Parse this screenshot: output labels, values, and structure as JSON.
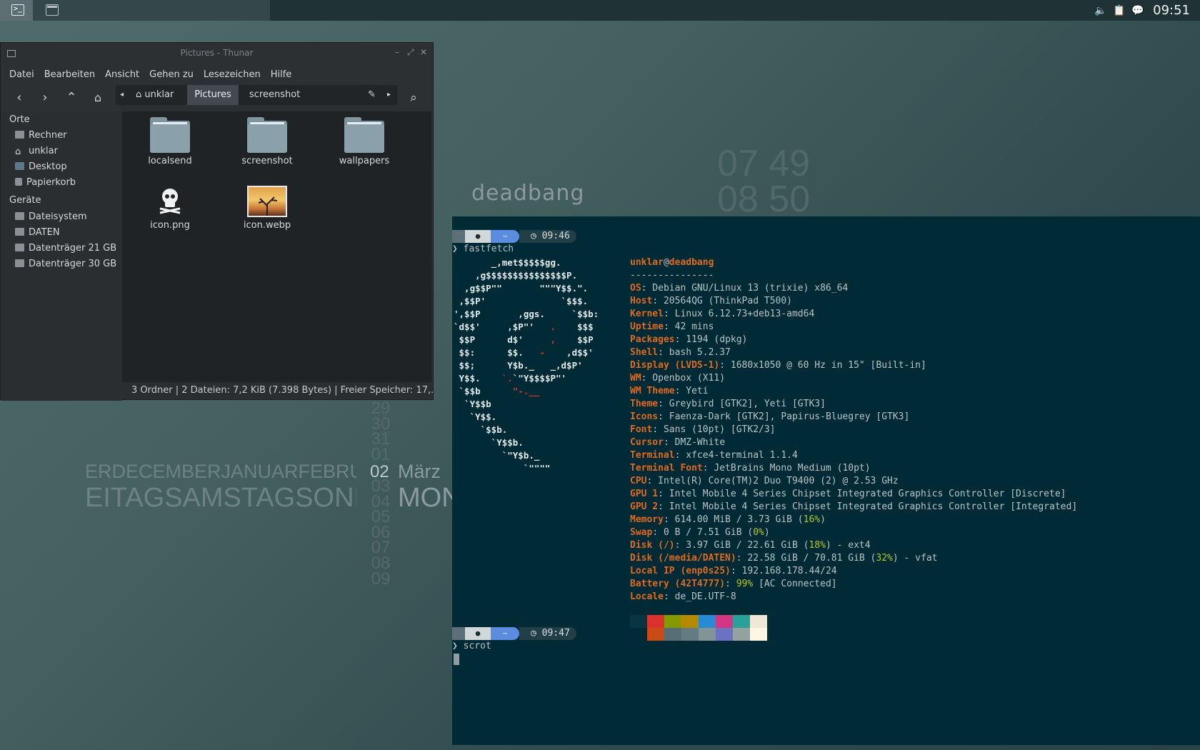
{
  "panel": {
    "tray_icons": [
      "speaker-icon",
      "clipboard-icon",
      "chat-icon"
    ],
    "clock": "09:51"
  },
  "thunar": {
    "title": "Pictures - Thunar",
    "menu": [
      "Datei",
      "Bearbeiten",
      "Ansicht",
      "Gehen zu",
      "Lesezeichen",
      "Hilfe"
    ],
    "path": [
      "unklar",
      "Pictures",
      "screenshot"
    ],
    "sidebar": {
      "places_header": "Orte",
      "places": [
        "Rechner",
        "unklar",
        "Desktop",
        "Papierkorb"
      ],
      "devices_header": "Geräte",
      "devices": [
        "Dateisystem",
        "DATEN",
        "Datenträger 21 GB",
        "Datenträger 30 GB"
      ]
    },
    "files": [
      "localsend",
      "screenshot",
      "wallpapers",
      "icon.png",
      "icon.webp"
    ],
    "status": "3 Ordner  |  2 Dateien: 7,2 KiB (7.398 Bytes)  |  Freier Speicher: 17,..."
  },
  "desktop": {
    "hostname_logo": "deadbang",
    "clock_rows": [
      "07  49",
      "08  50"
    ],
    "months": "ERDECEMBERJANUARFEBRUAR",
    "days": "EITAGSAMSTAGSONNTAG",
    "numbers_above": [
      "29",
      "30",
      "31",
      "01"
    ],
    "current_number": "02",
    "numbers_below": [
      "03",
      "04",
      "05",
      "06",
      "07",
      "08",
      "09"
    ],
    "current_month": "März",
    "current_day": "MON"
  },
  "terminal": {
    "prompt1_time": "◷ 09:46",
    "prompt1_cmd": "❯ fastfetch",
    "user": "unklar",
    "host": "deadbang",
    "separator": "---------------",
    "info": [
      {
        "k": "OS",
        "v": ": Debian GNU/Linux 13 (trixie) x86_64"
      },
      {
        "k": "Host",
        "v": ": 20564QG (ThinkPad T500)"
      },
      {
        "k": "Kernel",
        "v": ": Linux 6.12.73+deb13-amd64"
      },
      {
        "k": "Uptime",
        "v": ": 42 mins"
      },
      {
        "k": "Packages",
        "v": ": 1194 (dpkg)"
      },
      {
        "k": "Shell",
        "v": ": bash 5.2.37"
      },
      {
        "k": "Display (LVDS-1)",
        "v": ": 1680x1050 @ 60 Hz in 15\" [Built-in]"
      },
      {
        "k": "WM",
        "v": ": Openbox (X11)"
      },
      {
        "k": "WM Theme",
        "v": ": Yeti"
      },
      {
        "k": "Theme",
        "v": ": Greybird [GTK2], Yeti [GTK3]"
      },
      {
        "k": "Icons",
        "v": ": Faenza-Dark [GTK2], Papirus-Bluegrey [GTK3]"
      },
      {
        "k": "Font",
        "v": ": Sans (10pt) [GTK2/3]"
      },
      {
        "k": "Cursor",
        "v": ": DMZ-White"
      },
      {
        "k": "Terminal",
        "v": ": xfce4-terminal 1.1.4"
      },
      {
        "k": "Terminal Font",
        "v": ": JetBrains Mono Medium (10pt)"
      },
      {
        "k": "CPU",
        "v": ": Intel(R) Core(TM)2 Duo T9400 (2) @ 2.53 GHz"
      },
      {
        "k": "GPU 1",
        "v": ": Intel Mobile 4 Series Chipset Integrated Graphics Controller [Discrete]"
      },
      {
        "k": "GPU 2",
        "v": ": Intel Mobile 4 Series Chipset Integrated Graphics Controller [Integrated]"
      },
      {
        "k": "Memory",
        "v": ": 614.00 MiB / 3.73 GiB (",
        "h": "16%",
        "t": ")"
      },
      {
        "k": "Swap",
        "v": ": 0 B / 7.51 GiB (",
        "h": "0%",
        "t": ")"
      },
      {
        "k": "Disk (/)",
        "v": ": 3.97 GiB / 22.61 GiB (",
        "h": "18%",
        "t": ") - ext4"
      },
      {
        "k": "Disk (/media/DATEN)",
        "v": ": 22.58 GiB / 70.81 GiB (",
        "h": "32%",
        "t": ") - vfat"
      },
      {
        "k": "Local IP (enp0s25)",
        "v": ": 192.168.178.44/24"
      },
      {
        "k": "Battery (42T4777)",
        "v": ": ",
        "h": "99%",
        "t": " [AC Connected]"
      },
      {
        "k": "Locale",
        "v": ": de_DE.UTF-8"
      }
    ],
    "palette_top": [
      "#073642",
      "#dc322f",
      "#859900",
      "#b58900",
      "#268bd2",
      "#d33682",
      "#2aa198",
      "#eee8d5"
    ],
    "palette_bottom": [
      "#002b36",
      "#cb4b16",
      "#586e75",
      "#657b83",
      "#839496",
      "#6c71c4",
      "#93a1a1",
      "#fdf6e3"
    ],
    "prompt2_time": "◷ 09:47",
    "prompt2_cmd": "❯ scrot"
  }
}
